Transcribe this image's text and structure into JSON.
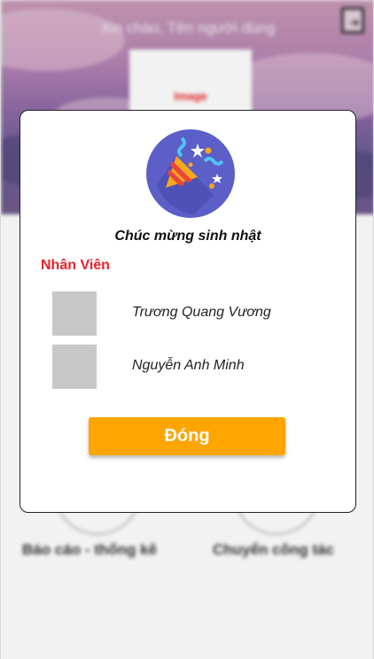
{
  "app": {
    "greeting": "Xin chào, Tên người dùng",
    "header_image_label": "Image",
    "logout_icon": "logout-icon",
    "menu": [
      {
        "label": "Báo cáo - thống kê"
      },
      {
        "label": "Chuyển công tác"
      }
    ]
  },
  "dialog": {
    "icon": "party-popper-icon",
    "title": "Chúc mừng sinh nhật",
    "section_label": "Nhân Viên",
    "employees": [
      {
        "name": "Trương Quang Vương"
      },
      {
        "name": "Nguyễn Anh Minh"
      }
    ],
    "close_label": "Đóng"
  },
  "colors": {
    "accent": "#ffa500",
    "section_label": "#e8232a",
    "icon_circle": "#5b5fc7",
    "avatar_placeholder": "#c8c8c8"
  }
}
